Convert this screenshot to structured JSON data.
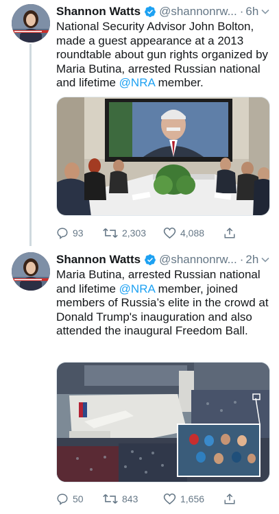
{
  "tweets": [
    {
      "author_name": "Shannon Watts",
      "handle": "@shannonrw...",
      "separator": "·",
      "time": "6h",
      "text_parts": [
        "National Security Advisor John Bolton, made a guest appearance at a 2013 roundtable about gun rights organized by Maria Butina, arrested Russian national and lifetime ",
        "@NRA",
        " member."
      ],
      "replies": "93",
      "retweets": "2,303",
      "likes": "4,088",
      "image_subject": "roundtable-meeting"
    },
    {
      "author_name": "Shannon Watts",
      "handle": "@shannonrw...",
      "separator": "·",
      "time": "2h",
      "text_parts": [
        "Maria Butina, arrested Russian national and lifetime ",
        "@NRA",
        " member, joined members of Russia’s elite in the crowd at Donald Trump's inauguration and also attended the inaugural Freedom Ball."
      ],
      "replies": "50",
      "retweets": "843",
      "likes": "1,656",
      "image_subject": "inauguration-crowd"
    }
  ],
  "colors": {
    "link": "#1da1f2",
    "verified": "#1da1f2",
    "secondary_text": "#657786",
    "thread_line": "#cfd9de"
  },
  "icons": [
    "verified-badge-icon",
    "chevron-down-icon",
    "reply-icon",
    "retweet-icon",
    "like-icon",
    "share-icon"
  ]
}
